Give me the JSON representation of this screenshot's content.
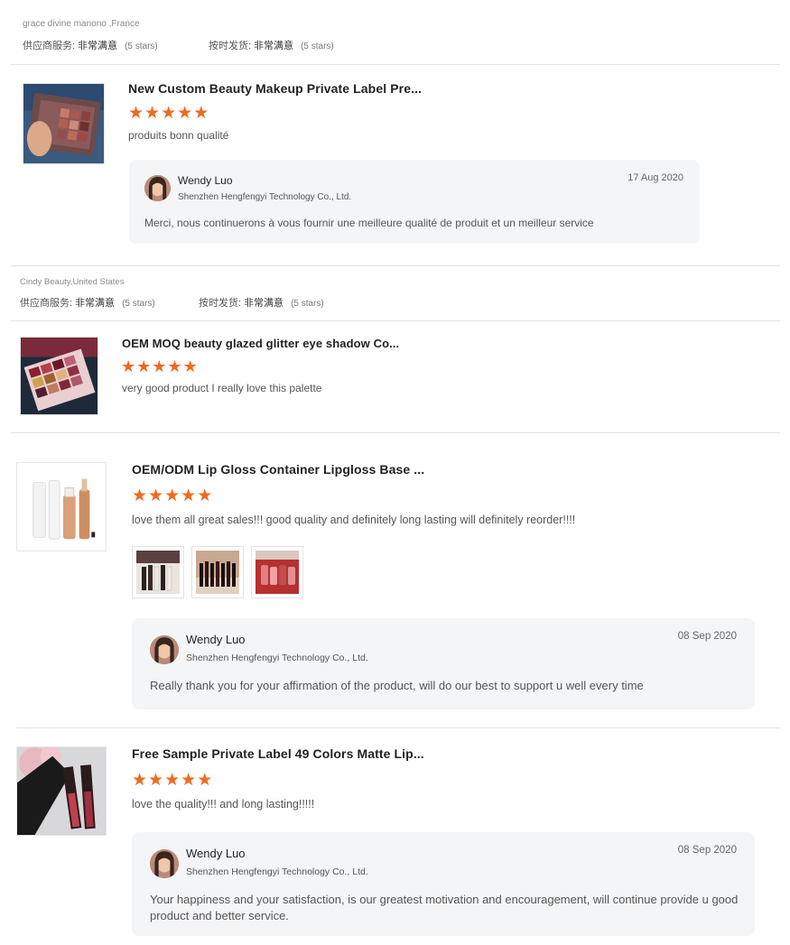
{
  "reviews": [
    {
      "reviewer": "grace divine manono ,France",
      "supplier_service_label": "供应商服务:",
      "supplier_service_value": "非常满意",
      "supplier_service_stars": "(5 stars)",
      "on_time_label": "按时发货:",
      "on_time_value": "非常满意",
      "on_time_stars": "(5 stars)",
      "product_title": "New Custom Beauty Makeup Private Label Pre...",
      "rating": 5,
      "comment": "produits bonn qualité",
      "reply": {
        "seller": "Wendy Luo",
        "company": "Shenzhen Hengfengyi Technology Co., Ltd.",
        "date": "17 Aug 2020",
        "text": "Merci, nous continuerons à vous fournir une meilleure qualité de produit et un meilleur service"
      }
    },
    {
      "reviewer": "Cindy Beauty,United States",
      "supplier_service_label": "供应商服务:",
      "supplier_service_value": "非常满意",
      "supplier_service_stars": "(5 stars)",
      "on_time_label": "按时发货:",
      "on_time_value": "非常满意",
      "on_time_stars": "(5 stars)",
      "product_title": "OEM MOQ beauty glazed glitter eye shadow Co...",
      "rating": 5,
      "comment": "very good product I really love this palette"
    },
    {
      "product_title": "OEM/ODM Lip Gloss Container Lipgloss Base ...",
      "rating": 5,
      "comment": "love them all great sales!!! good quality and definitely long lasting will definitely reorder!!!!",
      "reply": {
        "seller": "Wendy Luo",
        "company": "Shenzhen Hengfengyi Technology Co., Ltd.",
        "date": "08 Sep 2020",
        "text": "Really thank you for your affirmation of the product, will do our best to support u well every time"
      }
    },
    {
      "product_title": "Free Sample Private Label 49 Colors Matte Lip...",
      "rating": 5,
      "comment": "love the quality!!! and long lasting!!!!!",
      "reply": {
        "seller": "Wendy Luo",
        "company": "Shenzhen Hengfengyi Technology Co., Ltd.",
        "date": "08 Sep 2020",
        "text": "Your happiness and your satisfaction, is our greatest motivation and encouragement, will continue provide u good product and better service."
      }
    }
  ],
  "icons": {
    "star": "star-icon"
  },
  "colors": {
    "star": "#ee6a1f",
    "reply_bg": "#f4f5f7",
    "divider": "#e2e2e2"
  }
}
